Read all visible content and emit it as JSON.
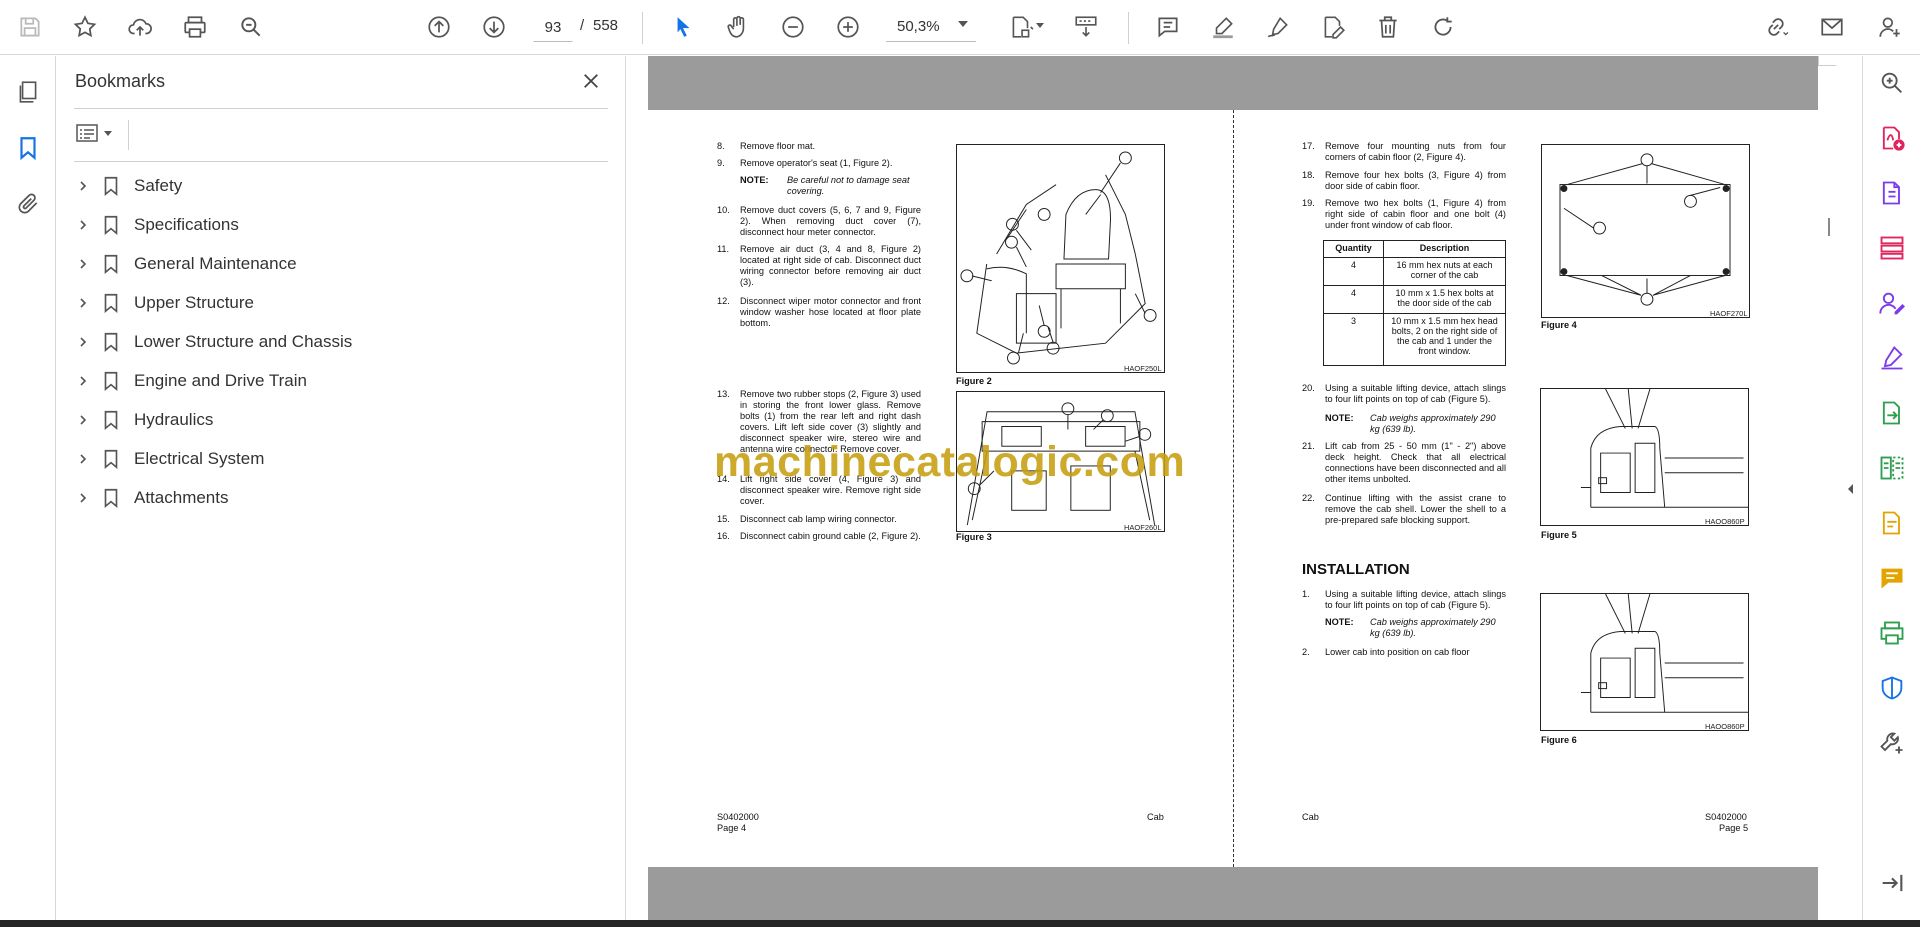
{
  "toolbar": {
    "current_page": "93",
    "page_separator": "/",
    "total_pages": "558",
    "zoom": "50,3%",
    "icons": [
      "save-icon",
      "star-icon",
      "cloud-upload-icon",
      "print-icon",
      "find-icon",
      "page-up-icon",
      "page-down-icon",
      "select-cursor-icon",
      "hand-icon",
      "zoom-out-icon",
      "zoom-in-icon",
      "fit-page-icon",
      "scroll-mode-icon",
      "comment-icon",
      "highlight-icon",
      "sign-icon",
      "edit-icon",
      "delete-icon",
      "rotate-icon",
      "share-link-icon",
      "email-icon",
      "account-icon"
    ]
  },
  "left_rail": {
    "icons": [
      "pages-icon",
      "bookmark-icon",
      "attachment-icon"
    ]
  },
  "bookmarks": {
    "title": "Bookmarks",
    "items": [
      {
        "label": "Safety"
      },
      {
        "label": "Specifications"
      },
      {
        "label": "General Maintenance"
      },
      {
        "label": "Upper Structure"
      },
      {
        "label": "Lower Structure and Chassis"
      },
      {
        "label": "Engine and Drive Train"
      },
      {
        "label": "Hydraulics"
      },
      {
        "label": "Electrical System"
      },
      {
        "label": "Attachments"
      }
    ]
  },
  "document": {
    "left_page": {
      "steps": [
        {
          "n": "8.",
          "text": "Remove floor mat."
        },
        {
          "n": "9.",
          "text": "Remove operator's seat (1, Figure 2)."
        },
        {
          "n": "10.",
          "text": "Remove duct covers (5, 6, 7 and 9, Figure 2). When removing duct cover (7), disconnect hour meter connector."
        },
        {
          "n": "11.",
          "text": "Remove air duct (3, 4 and 8, Figure 2) located at right side of cab. Disconnect duct wiring connector before removing air duct (3)."
        },
        {
          "n": "12.",
          "text": "Disconnect wiper motor connector and front window washer hose located at floor plate bottom."
        },
        {
          "n": "13.",
          "text": "Remove two rubber stops (2, Figure 3) used in storing the front lower glass. Remove bolts (1) from the rear left and right dash covers. Lift left side cover (3) slightly and disconnect speaker wire, stereo wire and antenna wire connector. Remove cover."
        },
        {
          "n": "14.",
          "text": "Lift right side cover (4, Figure 3) and disconnect speaker wire. Remove right side cover."
        },
        {
          "n": "15.",
          "text": "Disconnect cab lamp wiring connector."
        },
        {
          "n": "16.",
          "text": "Disconnect cabin ground cable (2, Figure 2)."
        }
      ],
      "note_label": "NOTE:",
      "note_text": "Be careful not to damage seat covering.",
      "figure2_caption": "Figure 2",
      "figure2_code": "HAOF250L",
      "figure3_caption": "Figure 3",
      "figure3_code": "HAOF260L",
      "footer_code": "S0402000",
      "footer_page": "Page 4",
      "footer_section": "Cab"
    },
    "right_page": {
      "steps": [
        {
          "n": "17.",
          "text": "Remove four mounting nuts from four corners of cabin floor (2, Figure 4)."
        },
        {
          "n": "18.",
          "text": "Remove four hex bolts (3, Figure 4) from door side of cabin floor."
        },
        {
          "n": "19.",
          "text": "Remove two hex bolts (1, Figure 4) from right side of cabin floor and one bolt (4) under front window of cab floor."
        },
        {
          "n": "20.",
          "text": "Using a suitable lifting device, attach slings to four lift points on top of cab (Figure 5)."
        },
        {
          "n": "21.",
          "text": "Lift cab from 25 - 50 mm (1\" - 2\") above deck height. Check that all electrical connections have been disconnected and all other items unbolted."
        },
        {
          "n": "22.",
          "text": "Continue lifting with the assist crane to remove the cab shell. Lower the shell to a pre-prepared safe blocking support."
        }
      ],
      "table": {
        "headers": [
          "Quantity",
          "Description"
        ],
        "rows": [
          [
            "4",
            "16 mm hex nuts at each corner of the cab"
          ],
          [
            "4",
            "10 mm x 1.5 hex bolts at the door side of the cab"
          ],
          [
            "3",
            "10 mm x 1.5 mm hex head bolts, 2 on the right side of the cab and 1 under the front window."
          ]
        ]
      },
      "note_label": "NOTE:",
      "note_text": "Cab weighs approximately 290 kg (639 lb).",
      "installation_heading": "INSTALLATION",
      "install_steps": [
        {
          "n": "1.",
          "text": "Using a suitable lifting device, attach slings to four lift points on top of cab (Figure 5)."
        },
        {
          "n": "2.",
          "text": "Lower cab into position on cab floor"
        }
      ],
      "install_note_label": "NOTE:",
      "install_note_text": "Cab weighs approximately 290 kg (639 lb).",
      "figure4_caption": "Figure 4",
      "figure4_code": "HAOF270L",
      "figure5_caption": "Figure 5",
      "figure5_code": "HAOO860P",
      "figure6_caption": "Figure 6",
      "figure6_code": "HAOO860P",
      "footer_section": "Cab",
      "footer_code": "S0402000",
      "footer_page": "Page 5"
    },
    "watermark": "machinecatalogic.com"
  },
  "right_rail": {
    "icons": [
      "zoom-tool-icon",
      "create-pdf-icon",
      "export-pdf-icon",
      "organize-pages-icon",
      "request-signature-icon",
      "fill-sign-icon",
      "convert-icon",
      "compare-icon",
      "edit-pdf-icon",
      "comment-tool-icon",
      "print-production-icon",
      "protect-icon",
      "more-tools-icon",
      "expand-panel-icon"
    ]
  },
  "colors": {
    "accent_blue": "#1473e6",
    "tool_pink": "#e0245e",
    "tool_purple": "#7c3aed",
    "tool_green": "#2e9e4f",
    "tool_yellow": "#e3a400",
    "watermark": "#c69e0e"
  }
}
